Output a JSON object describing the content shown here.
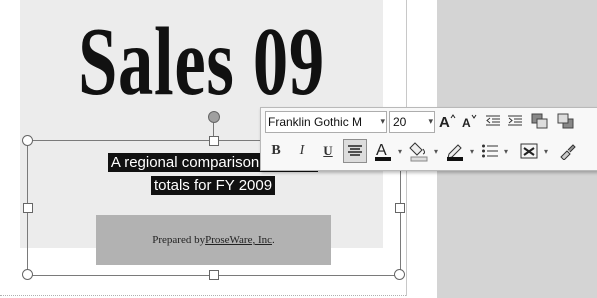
{
  "slide": {
    "title": "Sales 09",
    "subtitle_line1": "A regional comparison of sales",
    "subtitle_line2": "totals for FY 2009",
    "prepared_prefix": "Prepared by ",
    "prepared_company": "ProseWare, Inc",
    "prepared_suffix": "."
  },
  "toolbar": {
    "font_name": "Franklin Gothic M",
    "font_size": "20",
    "bold_label": "B",
    "italic_label": "I",
    "underline_label": "U",
    "font_color_label": "A",
    "font_color": "#111111",
    "highlight_color": "#f2c200",
    "grow_font_icon": "grow-font-icon",
    "shrink_font_icon": "shrink-font-icon",
    "decrease_indent_icon": "decrease-indent-icon",
    "increase_indent_icon": "increase-indent-icon",
    "bring_forward_icon": "bring-forward-icon",
    "send_backward_icon": "send-backward-icon",
    "center_align_icon": "center-align-icon",
    "shape_fill_icon": "paint-bucket-icon",
    "shape_outline_icon": "pen-outline-icon",
    "bullets_icon": "bullets-icon",
    "quick_styles_icon": "quick-styles-icon",
    "format_painter_icon": "format-painter-icon"
  }
}
